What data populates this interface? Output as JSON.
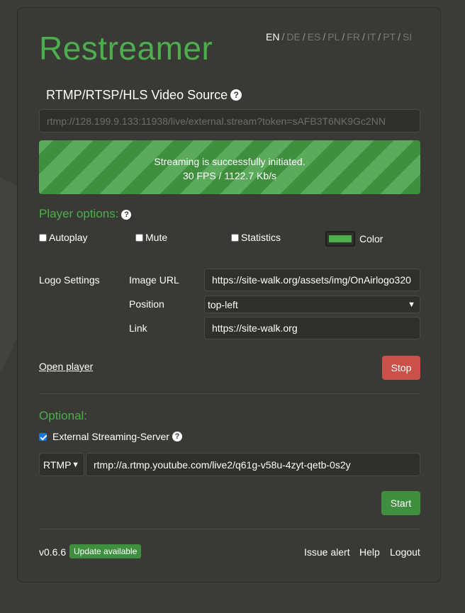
{
  "app": {
    "brand": "Restreamer"
  },
  "languages": {
    "items": [
      {
        "code": "EN",
        "active": true
      },
      {
        "code": "DE",
        "active": false
      },
      {
        "code": "ES",
        "active": false
      },
      {
        "code": "PL",
        "active": false
      },
      {
        "code": "FR",
        "active": false
      },
      {
        "code": "IT",
        "active": false
      },
      {
        "code": "PT",
        "active": false
      },
      {
        "code": "SI",
        "active": false
      }
    ],
    "separator": "/"
  },
  "source": {
    "title": "RTMP/RTSP/HLS Video Source",
    "help_icon": "question-circle-icon",
    "value": "rtmp://128.199.9.133:11938/live/external.stream?token=sAFB3T6NK9Gc2NN"
  },
  "status": {
    "message": "Streaming is successfully initiated.",
    "stats": "30 FPS / 1122.7 Kb/s"
  },
  "player_options": {
    "title": "Player options:",
    "autoplay": {
      "label": "Autoplay",
      "checked": false
    },
    "mute": {
      "label": "Mute",
      "checked": false
    },
    "statistics": {
      "label": "Statistics",
      "checked": false
    },
    "color": {
      "label": "Color",
      "value": "#4cae4c"
    }
  },
  "logo": {
    "section_label": "Logo Settings",
    "image_url_label": "Image URL",
    "image_url_value": "https://site-walk.org/assets/img/OnAirlogo320",
    "position_label": "Position",
    "position_value": "top-left",
    "link_label": "Link",
    "link_value": "https://site-walk.org"
  },
  "actions": {
    "open_player": "Open player",
    "stop": "Stop",
    "start": "Start"
  },
  "optional": {
    "title": "Optional:",
    "external_label": "External Streaming-Server",
    "external_checked": true,
    "protocol": "RTMP",
    "url": "rtmp://a.rtmp.youtube.com/live2/q61g-v58u-4zyt-qetb-0s2y"
  },
  "footer": {
    "version": "v0.6.6",
    "update_badge": "Update available",
    "issue_alert": "Issue alert",
    "help": "Help",
    "logout": "Logout"
  }
}
